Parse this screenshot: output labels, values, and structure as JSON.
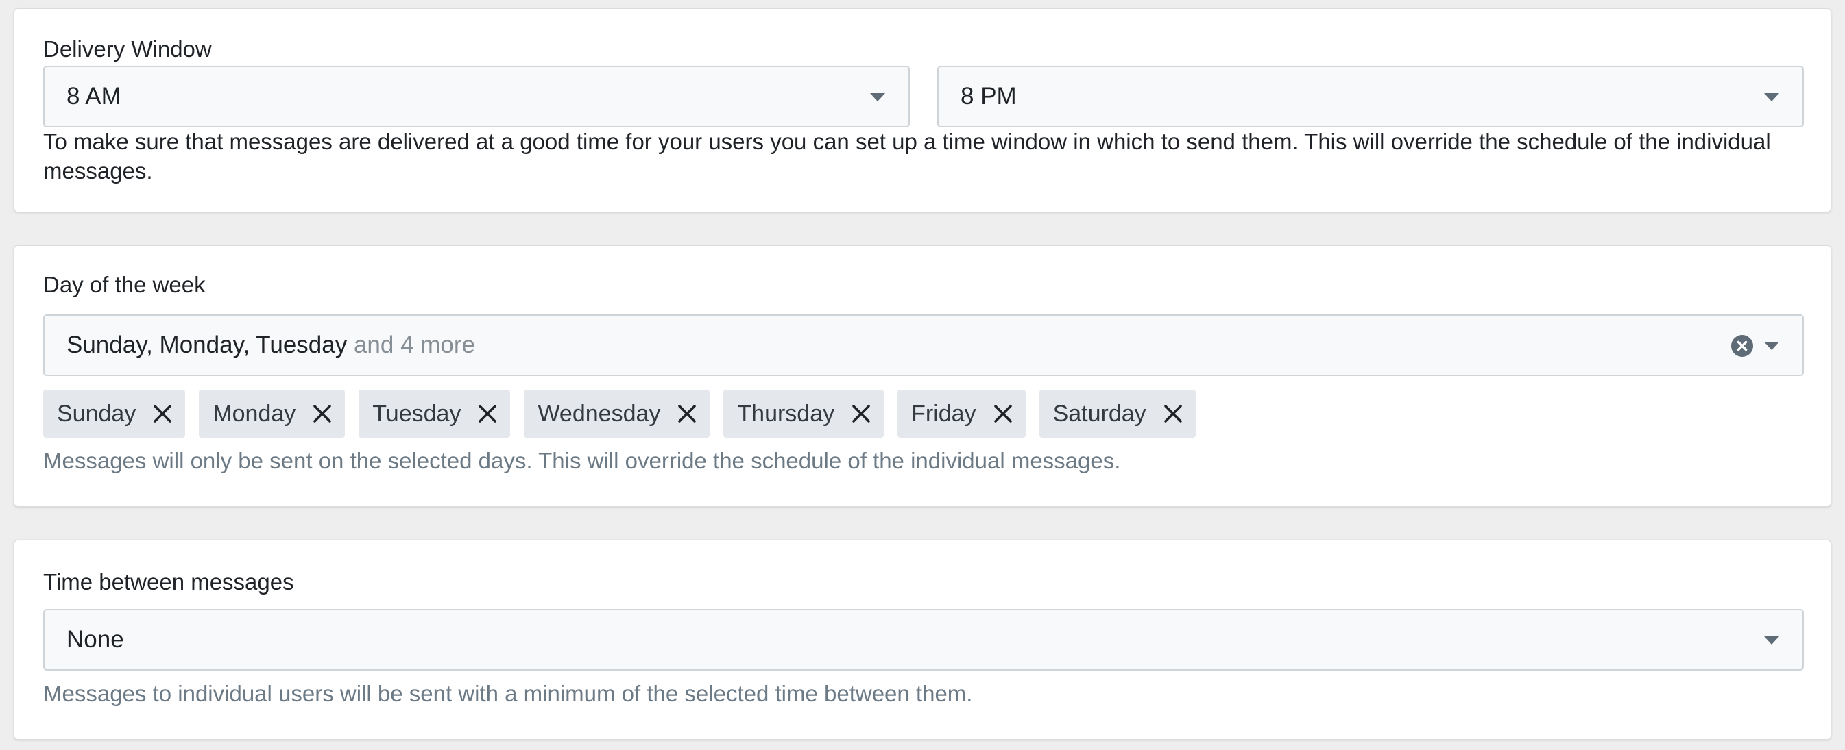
{
  "delivery_window": {
    "label": "Delivery Window",
    "start": "8 AM",
    "end": "8 PM",
    "help": "To make sure that messages are delivered at a good time for your users you can set up a time window in which to send them. This will override the schedule of the individual messages."
  },
  "day_of_week": {
    "label": "Day of the week",
    "summary": "Sunday, Monday, Tuesday",
    "summary_more": "and 4 more",
    "tags": [
      "Sunday",
      "Monday",
      "Tuesday",
      "Wednesday",
      "Thursday",
      "Friday",
      "Saturday"
    ],
    "help": "Messages will only be sent on the selected days. This will override the schedule of the individual messages."
  },
  "time_between": {
    "label": "Time between messages",
    "value": "None",
    "help": "Messages to individual users will be sent with a minimum of the selected time between them."
  },
  "icons": {
    "dropdown": "chevron-down-icon",
    "clear": "clear-circle-icon",
    "remove": "close-icon"
  },
  "colors": {
    "background": "#eeeeee",
    "card": "#ffffff",
    "tag_bg": "#e4e7eb",
    "muted_text": "#6c7a86"
  }
}
